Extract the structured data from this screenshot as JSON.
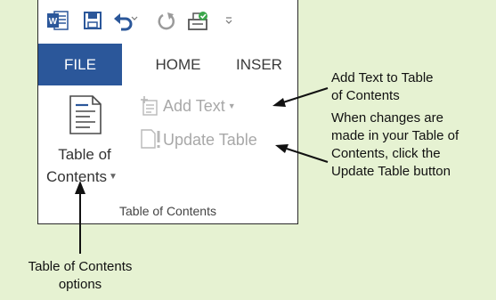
{
  "ribbon": {
    "tabs": [
      "FILE",
      "HOME",
      "INSER"
    ],
    "add_text": "Add Text",
    "update_table": "Update Table",
    "toc_line1": "Table of",
    "toc_line2": "Contents",
    "group_label": "Table of Contents"
  },
  "callouts": {
    "add_text_line1": "Add Text to Table",
    "add_text_line2": "of Contents",
    "update_line1": "When changes are",
    "update_line2": "made in your Table of",
    "update_line3": "Contents, click the",
    "update_line4": "Update Table button",
    "options_line1": "Table of Contents",
    "options_line2": "options"
  },
  "colors": {
    "background": "#e6f2d2",
    "file_tab": "#2b579a",
    "word_blue": "#2b579a",
    "disabled_text": "#a8a8a8"
  },
  "icons": [
    "word-logo-icon",
    "save-icon",
    "undo-icon",
    "redo-icon",
    "touch-mode-icon",
    "qat-more-icon",
    "toc-icon",
    "add-text-icon",
    "update-table-icon",
    "dropdown-arrow-icon"
  ]
}
